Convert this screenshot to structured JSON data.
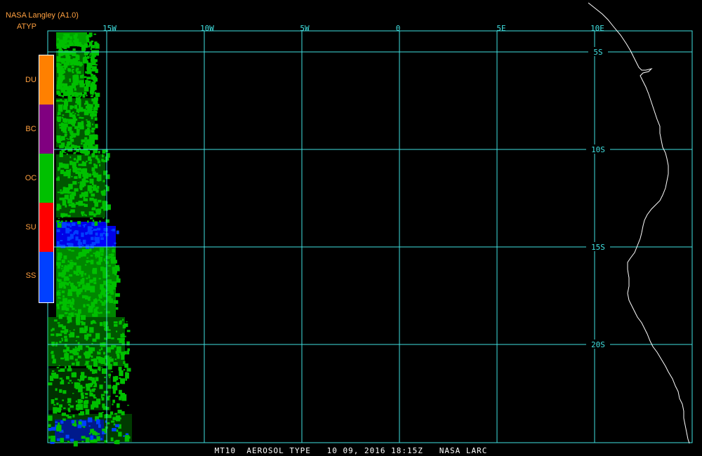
{
  "header": {
    "title": "NASA Langley (A1.0)",
    "product": "ATYP"
  },
  "legend": {
    "items": [
      {
        "code": "DU",
        "color": "#ff8000"
      },
      {
        "code": "BC",
        "color": "#800080"
      },
      {
        "code": "OC",
        "color": "#00c000"
      },
      {
        "code": "SU",
        "color": "#ff0000"
      },
      {
        "code": "SS",
        "color": "#0040ff"
      }
    ]
  },
  "grid": {
    "longitude_labels": [
      "15W",
      "10W",
      "5W",
      "0",
      "5E",
      "10E"
    ],
    "latitude_labels": [
      "5S",
      "10S",
      "15S",
      "20S"
    ],
    "color": "#40e0e0"
  },
  "coastline_color": "#ffffff",
  "footer": {
    "caption": "MT10  AEROSOL TYPE   10 09, 2016 18:15Z   NASA LARC"
  }
}
